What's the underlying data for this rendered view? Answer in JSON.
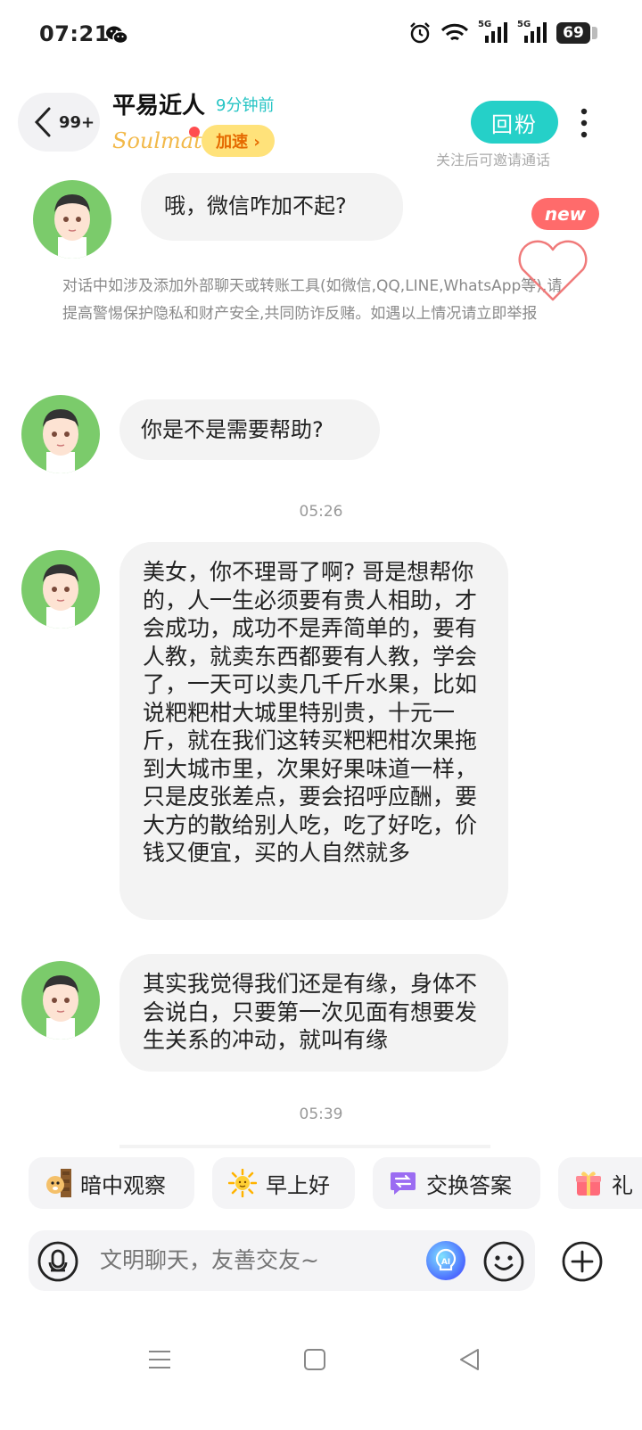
{
  "status_bar": {
    "time": "07:21",
    "signal1_label": "5G",
    "signal2_label": "5G",
    "battery": "69",
    "icons": [
      "wechat-icon",
      "alarm-icon",
      "wifi-icon",
      "signal-icon",
      "signal-icon",
      "battery-icon"
    ]
  },
  "header": {
    "back_count": "99+",
    "name": "平易近人",
    "last_seen": "9分钟前",
    "brand": "Soulmate",
    "boost_label": "加速 ›",
    "follow_label": "回粉",
    "follow_hint": "关注后可邀请通话"
  },
  "messages": [
    {
      "text": "哦，微信咋加不起?"
    },
    {
      "text": "你是不是需要帮助?"
    },
    {
      "text": "美女，你不理哥了啊? 哥是想帮你的，人一生必须要有贵人相助，才会成功，成功不是弄简单的，要有人教，就卖东西都要有人教，学会了，一天可以卖几千斤水果，比如说粑粑柑大城里特别贵，十元一斤，就在我们这转买粑粑柑次果拖到大城市里，次果好果味道一样，只是皮张差点，要会招呼应酬，要大方的散给别人吃，吃了好吃，价钱又便宜，买的人自然就多"
    },
    {
      "text": "其实我觉得我们还是有缘，身体不会说白，只要第一次见面有想要发生关系的冲动，就叫有缘"
    }
  ],
  "notice": "对话中如涉及添加外部聊天或转账工具(如微信,QQ,LINE,WhatsApp等),请提高警惕保护隐私和财产安全,共同防诈反赌。如遇以上情况请立即举报",
  "timestamps": [
    "05:26",
    "05:39"
  ],
  "new_badge": "new",
  "quick_replies": [
    {
      "label": "暗中观察",
      "icon": "dog-peek-icon"
    },
    {
      "label": "早上好",
      "icon": "sun-icon"
    },
    {
      "label": "交换答案",
      "icon": "swap-icon"
    },
    {
      "label": "礼",
      "icon": "gift-icon"
    }
  ],
  "input": {
    "placeholder": "文明聊天，友善交友~"
  },
  "colors": {
    "accent": "#25d0c8",
    "boost_bg": "#ffe27a",
    "badge": "#ff6b6b",
    "bubble": "#f3f3f3"
  }
}
